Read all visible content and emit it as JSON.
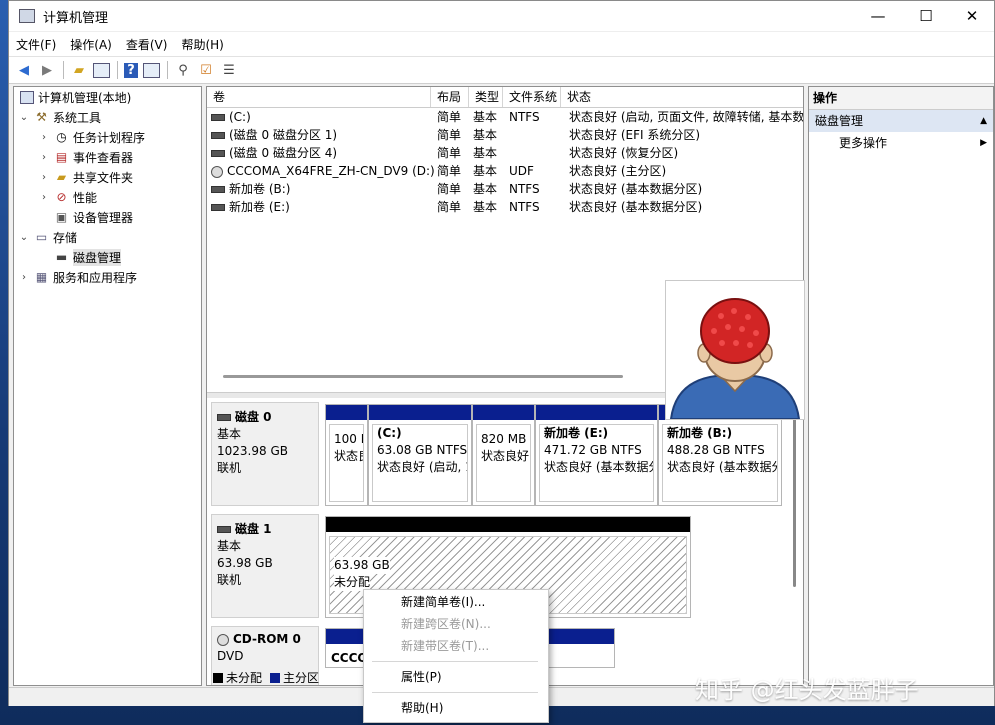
{
  "window": {
    "title": "计算机管理",
    "minimize": "—",
    "maximize": "☐",
    "close": "✕"
  },
  "menu": [
    "文件(F)",
    "操作(A)",
    "查看(V)",
    "帮助(H)"
  ],
  "tree": {
    "root": "计算机管理(本地)",
    "system_tools": "系统工具",
    "task_scheduler": "任务计划程序",
    "event_viewer": "事件查看器",
    "shared_folders": "共享文件夹",
    "performance": "性能",
    "device_manager": "设备管理器",
    "storage": "存储",
    "disk_management": "磁盘管理",
    "services": "服务和应用程序"
  },
  "volumes": {
    "headers": {
      "vol": "卷",
      "layout": "布局",
      "type": "类型",
      "fs": "文件系统",
      "status": "状态"
    },
    "rows": [
      {
        "vol": "(C:)",
        "layout": "简单",
        "type": "基本",
        "fs": "NTFS",
        "status": "状态良好 (启动, 页面文件, 故障转储, 基本数"
      },
      {
        "vol": "(磁盘 0 磁盘分区 1)",
        "layout": "简单",
        "type": "基本",
        "fs": "",
        "status": "状态良好 (EFI 系统分区)"
      },
      {
        "vol": "(磁盘 0 磁盘分区 4)",
        "layout": "简单",
        "type": "基本",
        "fs": "",
        "status": "状态良好 (恢复分区)"
      },
      {
        "vol": "CCCOMA_X64FRE_ZH-CN_DV9 (D:)",
        "layout": "简单",
        "type": "基本",
        "fs": "UDF",
        "status": "状态良好 (主分区)"
      },
      {
        "vol": "新加卷 (B:)",
        "layout": "简单",
        "type": "基本",
        "fs": "NTFS",
        "status": "状态良好 (基本数据分区)"
      },
      {
        "vol": "新加卷 (E:)",
        "layout": "简单",
        "type": "基本",
        "fs": "NTFS",
        "status": "状态良好 (基本数据分区)"
      }
    ]
  },
  "disks": {
    "disk0": {
      "name": "磁盘 0",
      "kind": "基本",
      "size": "1023.98 GB",
      "state": "联机",
      "parts": [
        {
          "l1": "",
          "l2": "100 I",
          "l3": "状态良"
        },
        {
          "l1": "(C:)",
          "l2": "63.08 GB NTFS",
          "l3": "状态良好 (启动, 1"
        },
        {
          "l1": "",
          "l2": "820 MB",
          "l3": "状态良好"
        },
        {
          "l1": "新加卷  (E:)",
          "l2": "471.72 GB NTFS",
          "l3": "状态良好 (基本数据分"
        },
        {
          "l1": "新加卷  (B:)",
          "l2": "488.28 GB NTFS",
          "l3": "状态良好 (基本数据分"
        }
      ]
    },
    "disk1": {
      "name": "磁盘 1",
      "kind": "基本",
      "size": "63.98 GB",
      "state": "联机",
      "p_size": "63.98 GB",
      "p_state": "未分配"
    },
    "cdrom": {
      "name": "CD-ROM 0",
      "kind": "DVD",
      "p_label": "CCCO"
    }
  },
  "legend": {
    "unallocated": "未分配",
    "primary": "主分区"
  },
  "actions": {
    "header": "操作",
    "section": "磁盘管理",
    "more": "更多操作"
  },
  "context_menu": {
    "new_simple": "新建简单卷(I)...",
    "new_spanned": "新建跨区卷(N)...",
    "new_striped": "新建带区卷(T)...",
    "properties": "属性(P)",
    "help": "帮助(H)"
  },
  "watermark": "知乎 @红头发蓝胖子",
  "colors": {
    "primary_partition": "#0a1f8f",
    "unallocated": "#000000",
    "accent": "#dde6f3"
  }
}
